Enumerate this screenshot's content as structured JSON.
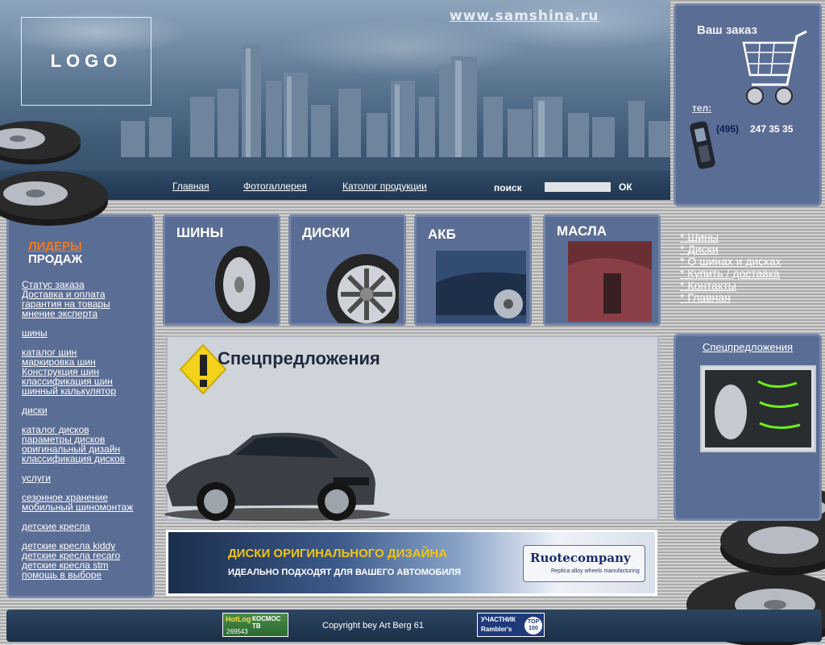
{
  "header": {
    "logo": "LOGO",
    "site_url": "www.samshina.ru",
    "nav": [
      "Главная",
      "Фотогаллерея",
      "Католог продукции"
    ],
    "search_label": "поиск",
    "search_button": "ОК"
  },
  "order": {
    "title": "Ваш заказ",
    "phone_label": "тел:",
    "phone_code": "(495)",
    "phone_number": "247 35 35"
  },
  "sidebar": {
    "leaders_line1": "ЛИДЕРЫ",
    "leaders_line2": "ПРОДАЖ",
    "links": [
      "Статус заказа",
      "Доставка и оплата",
      "гарантия на товары",
      "мнение эксперта",
      "шины",
      "каталог шин",
      "маркировка шин",
      "Конструкция шин",
      "классификация шин",
      "шинный калькулятор",
      "диски",
      "каталог дисков",
      "параметры дисков",
      "оригинальный дизайн",
      "классификация дисков",
      "услуги",
      "сезонное хранение",
      "мобильный шиномонтаж",
      "детские кресла",
      "детские кресла kiddy",
      "детские кресла recaro",
      "детские кресла stm",
      "помощь в выборе"
    ]
  },
  "categories": [
    "ШИНЫ",
    "ДИСКИ",
    "АКБ",
    "МАСЛА"
  ],
  "right_menu": [
    "* Шины",
    "* Диски",
    "* О шинах и дисках",
    "* Купить / доставка",
    "* Контакты",
    "* Главная"
  ],
  "special": {
    "title": "Спецпредложения",
    "side_title": "Спецпредложения"
  },
  "banner": {
    "line1": "ДИСКИ ОРИГИНАЛЬНОГО ДИЗАЙНА",
    "line2": "ИДЕАЛЬНО ПОДХОДЯТ ДЛЯ ВАШЕГО АВТОМОБИЛЯ",
    "logo_name": "Ruotecompany",
    "logo_sub": "Replica alloy wheels manufacturing"
  },
  "footer": {
    "copyright": "Copyright bey Art Berg 61",
    "counter1_a": "HotLog",
    "counter1_b": "КОСМОС ТВ",
    "counter1_c": "269543",
    "counter2_a": "УЧАСТНИК",
    "counter2_b": "Rambler's",
    "counter2_c": "TOP 100"
  }
}
